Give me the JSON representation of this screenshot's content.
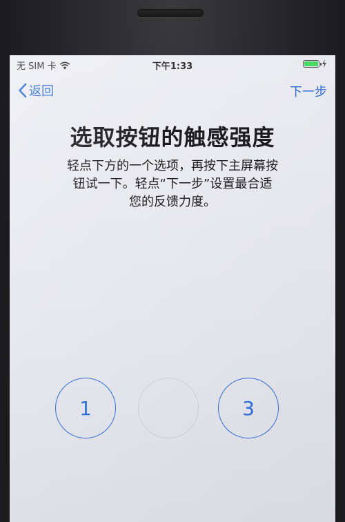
{
  "status_bar": {
    "carrier": "无 SIM 卡",
    "wifi_icon": "wifi-icon",
    "time": "下午1:33",
    "battery_level": 1.0,
    "battery_color": "#4cd964",
    "charging_icon": "charging-bolt-icon"
  },
  "nav": {
    "back_label": "返回",
    "back_icon": "chevron-left-icon",
    "next_label": "下一步",
    "accent_color": "#2f6fd6"
  },
  "main": {
    "title": "选取按钮的触感强度",
    "description_lines": [
      "轻点下方的一个选项，再按下主屏幕按",
      "钮试一下。轻点“下一步”设置最合适",
      "您的反馈力度。"
    ]
  },
  "options": [
    {
      "label": "1",
      "selected": false
    },
    {
      "label": "",
      "selected": true
    },
    {
      "label": "3",
      "selected": false
    }
  ]
}
